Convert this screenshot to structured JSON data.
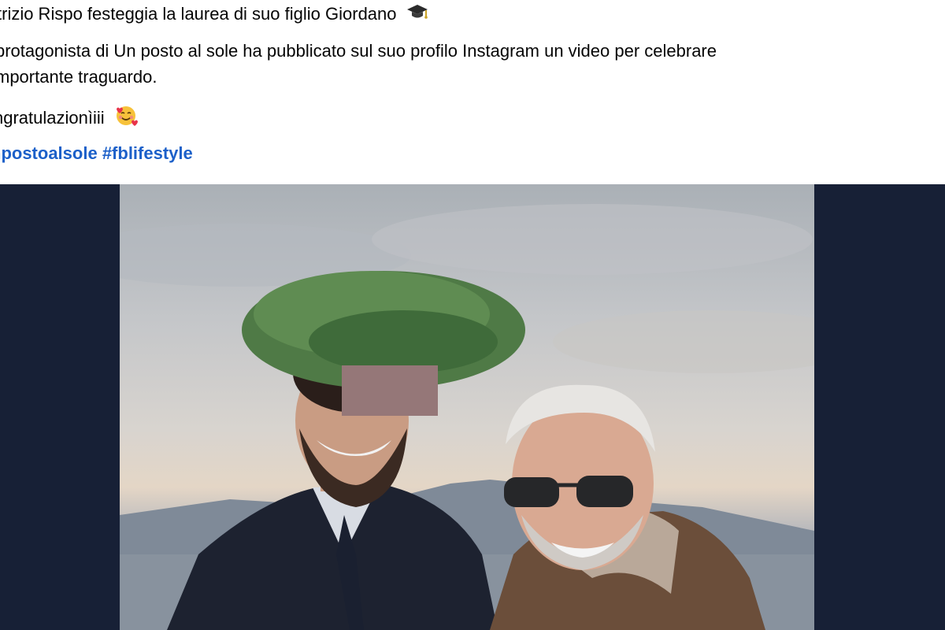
{
  "post": {
    "title_line": "trizio Rispo festeggia la laurea di suo figlio Giordano",
    "title_emoji": "graduation-cap-icon",
    "body_line1": "protagonista di Un posto al sole ha pubblicato sul suo profilo Instagram un video per celebrare",
    "body_line2": "mportante traguardo.",
    "congrats": "ngratulazionìiii",
    "congrats_emoji": "smiling-face-with-hearts-icon",
    "hashtag1": "npostoalsole",
    "hashtag2": "#fblifestyle"
  },
  "colors": {
    "hashtag": "#1c60c9",
    "media_background": "#172036"
  }
}
